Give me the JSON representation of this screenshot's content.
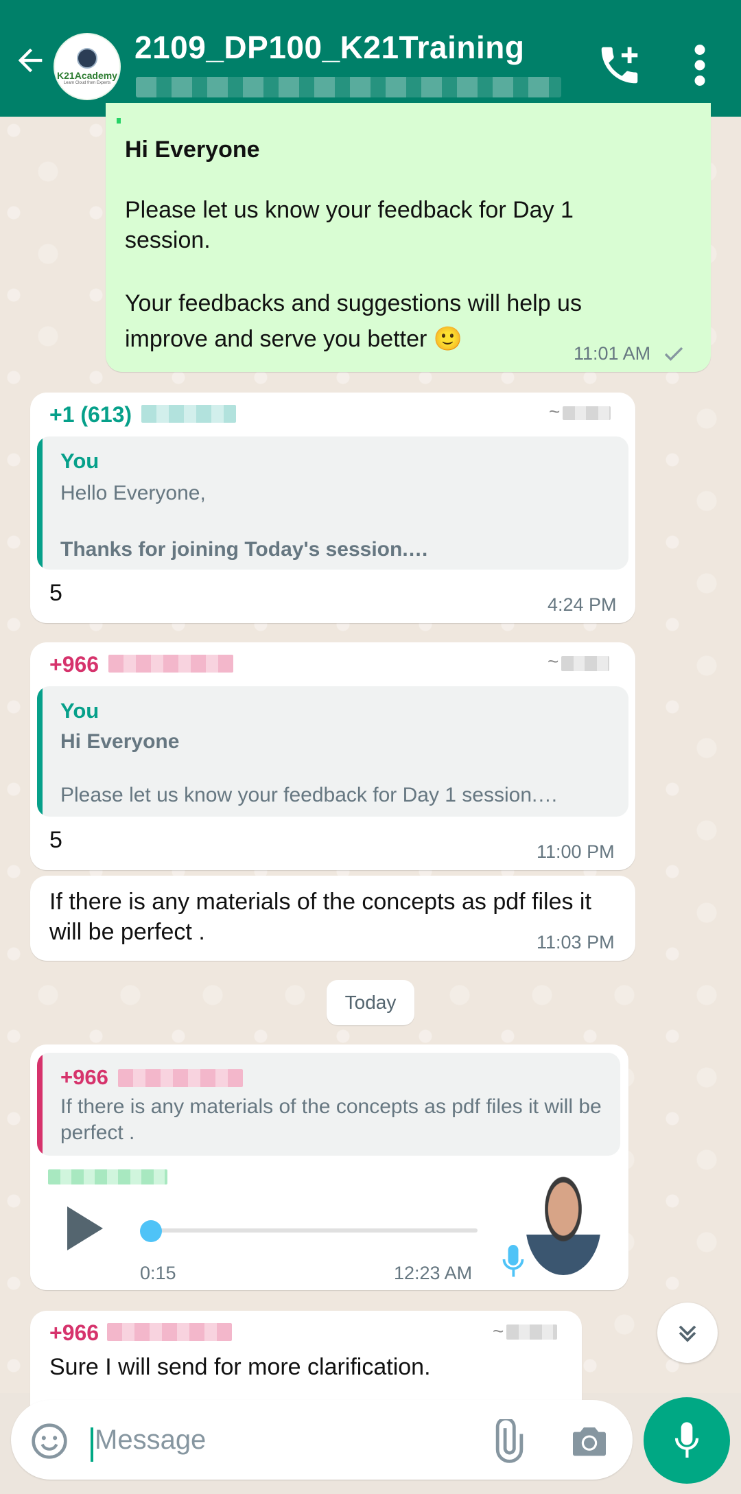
{
  "header": {
    "title": "2109_DP100_K21Training",
    "avatar_label": "K21Academy",
    "avatar_sub": "Learn Cloud from Experts"
  },
  "messages": {
    "m1": {
      "heading": "Hi Everyone",
      "line1": "Please let us know your feedback for Day 1 session.",
      "line2": "Your feedbacks and suggestions will help us improve and serve you better 🙂",
      "time": "11:01 AM"
    },
    "m2": {
      "sender": "+1 (613)",
      "quote_name": "You",
      "quote_line1": "Hello Everyone,",
      "quote_line2": "Thanks for joining Today's session.…",
      "text": "5",
      "time": "4:24 PM"
    },
    "m3": {
      "sender": "+966",
      "quote_name": "You",
      "quote_line1": "Hi Everyone",
      "quote_line2": "Please let us know your feedback for Day 1 session.…",
      "text": "5",
      "time": "11:00 PM"
    },
    "m4": {
      "text": "If there is any materials of the concepts  as pdf files it will be perfect .",
      "time": "11:03 PM"
    },
    "date_chip": "Today",
    "m5": {
      "quote_name": "+966",
      "quote_text": "If there is any materials of the concepts  as pdf files it will be perfect .",
      "duration": "0:15",
      "time": "12:23 AM"
    },
    "m6": {
      "sender": "+966",
      "text": "Sure I will send for more clarification."
    }
  },
  "input": {
    "placeholder": "Message"
  },
  "colors": {
    "header": "#008069",
    "outgoing_bubble": "#D9FDD3",
    "teal_name": "#06A08A",
    "pink_name": "#D6336C",
    "accent": "#00A884"
  },
  "icons": [
    "back-arrow-icon",
    "add-call-icon",
    "more-vert-icon",
    "read-check-icon",
    "play-icon",
    "mic-icon",
    "scroll-down-icon",
    "emoji-icon",
    "attach-icon",
    "camera-icon"
  ]
}
